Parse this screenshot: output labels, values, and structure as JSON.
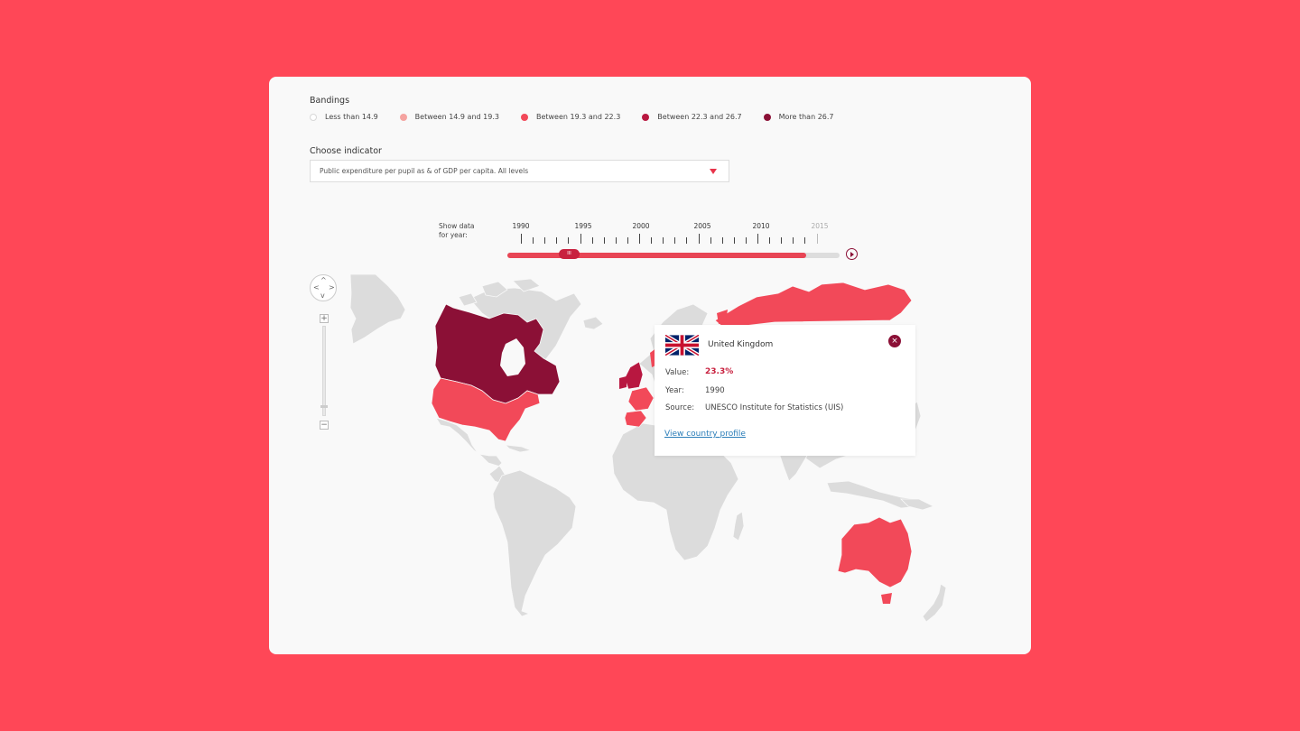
{
  "bandings": {
    "title": "Bandings",
    "items": [
      {
        "label": "Less than 14.9",
        "color": "#ffffff",
        "border": "#d8d8d8"
      },
      {
        "label": "Between 14.9 and 19.3",
        "color": "#f5a3a0",
        "border": "#f5a3a0"
      },
      {
        "label": "Between 19.3 and 22.3",
        "color": "#f24959",
        "border": "#f24959"
      },
      {
        "label": "Between 22.3 and 26.7",
        "color": "#b81740",
        "border": "#b81740"
      },
      {
        "label": "More than 26.7",
        "color": "#8b1036",
        "border": "#8b1036"
      }
    ]
  },
  "indicator": {
    "title": "Choose indicator",
    "selected": "Public expenditure per pupil as & of GDP per capita. All levels"
  },
  "timeline": {
    "label_line1": "Show data",
    "label_line2": "for year:",
    "years": [
      "1990",
      "1995",
      "2000",
      "2005",
      "2010",
      "2015"
    ],
    "selected_year": "1990",
    "progress": 0.9,
    "thumb_glyph": "III"
  },
  "map_controls": {
    "zoom_in": "+",
    "zoom_out": "−",
    "pan_up": "^",
    "pan_down": "v",
    "pan_left": "<",
    "pan_right": ">"
  },
  "popup": {
    "country": "United Kingdom",
    "value_label": "Value:",
    "value": "23.3%",
    "year_label": "Year:",
    "year": "1990",
    "source_label": "Source:",
    "source": "UNESCO Institute for Statistics (UIS)",
    "link": "View country profile",
    "close_glyph": "×",
    "flag_icon": "uk-flag-icon"
  },
  "map": {
    "no_data_color": "#dcdcdc",
    "highlighted": [
      {
        "country": "Canada",
        "band": "More than 26.7",
        "color": "#8b1036"
      },
      {
        "country": "United States",
        "band": "Between 19.3 and 22.3",
        "color": "#f24959"
      },
      {
        "country": "Russia",
        "band": "Between 19.3 and 22.3",
        "color": "#f24959"
      },
      {
        "country": "Australia",
        "band": "Between 19.3 and 22.3",
        "color": "#f24959"
      },
      {
        "country": "United Kingdom",
        "band": "Between 22.3 and 26.7",
        "color": "#b81740"
      }
    ]
  }
}
